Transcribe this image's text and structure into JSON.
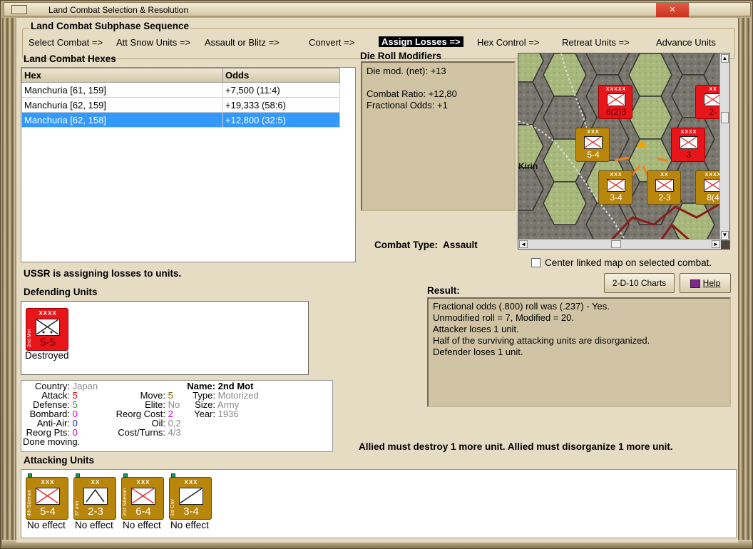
{
  "window": {
    "title": "Land Combat Selection & Resolution"
  },
  "subphase": {
    "title": "Land Combat Subphase Sequence",
    "phases": [
      "Select Combat =>",
      "Att Snow Units =>",
      "Assault or Blitz =>",
      "Convert =>",
      "Assign Losses =>",
      "Hex Control =>",
      "Retreat Units =>",
      "Advance Units"
    ],
    "active_index": 4
  },
  "hexes": {
    "title": "Land Combat Hexes",
    "columns": [
      "Hex",
      "Odds"
    ],
    "rows": [
      {
        "hex": "Manchuria [61, 159]",
        "odds": "+7,500 (11:4)"
      },
      {
        "hex": "Manchuria [62, 159]",
        "odds": "+19,333 (58:6)"
      },
      {
        "hex": "Manchuria [62, 158]",
        "odds": "+12,800 (32:5)"
      }
    ],
    "selected_index": 2
  },
  "drm": {
    "title": "Die Roll Modifiers",
    "lines": [
      "Die mod. (net): +13",
      "",
      "Combat Ratio: +12,80",
      "Fractional Odds: +1"
    ]
  },
  "map": {
    "label": "Kirin",
    "units": [
      {
        "size": "XXXXX",
        "str": "6(2)3",
        "color": "red"
      },
      {
        "size": "XXX",
        "str": "5-4",
        "color": "gold"
      },
      {
        "size": "XXXX",
        "str": "3",
        "color": "red"
      },
      {
        "size": "XXX",
        "str": "3-4",
        "color": "gold"
      },
      {
        "size": "XX",
        "str": "2-3",
        "color": "gold"
      },
      {
        "size": "XXXX",
        "str": "8(4",
        "color": "gold"
      },
      {
        "size": "XX",
        "str": "2-",
        "color": "red"
      }
    ]
  },
  "combat_type": {
    "label": "Combat Type:",
    "value": "Assault"
  },
  "center_map": {
    "label": "Center linked map on selected combat.",
    "checked": false
  },
  "buttons": {
    "charts": "2-D-10 Charts",
    "help": "Help"
  },
  "status": "USSR is assigning losses to units.",
  "result": {
    "title": "Result:",
    "lines": [
      "Fractional odds (.800) roll was (.237)  - Yes.",
      "Unmodified roll = 7, Modified = 20.",
      "Attacker loses 1 unit.",
      "Half of the surviving attacking units are disorganized.",
      "Defender loses 1 unit."
    ]
  },
  "defending": {
    "title": "Defending Units",
    "units": [
      {
        "name": "2nd Mot",
        "size": "XXXX",
        "str": "5-5",
        "status": "Destroyed"
      }
    ]
  },
  "unit_info": {
    "country_lbl": "Country:",
    "country": "Japan",
    "attack_lbl": "Attack:",
    "attack": "5",
    "defense_lbl": "Defense:",
    "defense": "5",
    "bombard_lbl": "Bombard:",
    "bombard": "0",
    "antiair_lbl": "Anti-Air:",
    "antiair": "0",
    "reorgpts_lbl": "Reorg Pts:",
    "reorgpts": "0",
    "done": "Done moving.",
    "move_lbl": "Move:",
    "move": "5",
    "elite_lbl": "Elite:",
    "elite": "No",
    "reorgcost_lbl": "Reorg Cost:",
    "reorgcost": "2",
    "oil_lbl": "Oil:",
    "oil": "0,2",
    "costturns_lbl": "Cost/Turns:",
    "costturns": "4/3",
    "name_lbl": "Name:",
    "name": "2nd Mot",
    "type_lbl": "Type:",
    "type": "Motorized",
    "size_lbl": "Size:",
    "size": "Army",
    "year_lbl": "Year:",
    "year": "1936"
  },
  "allied_msg": "Allied must destroy 1 more unit. Allied must disorganize 1 more unit.",
  "attacking": {
    "title": "Attacking Units",
    "units": [
      {
        "name": "4th Siberian",
        "size": "XXX",
        "str": "5-4",
        "status": "No effect"
      },
      {
        "name": "37 mm",
        "size": "XX",
        "str": "2-3",
        "status": "No effect"
      },
      {
        "name": "2nd Siberian",
        "size": "XXX",
        "str": "6-4",
        "status": "No effect"
      },
      {
        "name": "1st Cav",
        "size": "XXX",
        "str": "3-4",
        "status": "No effect"
      }
    ]
  }
}
